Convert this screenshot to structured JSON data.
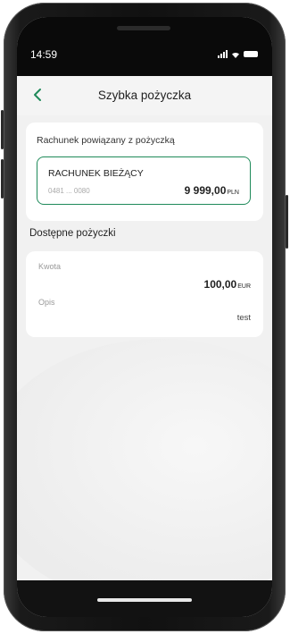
{
  "status_bar": {
    "time": "14:59"
  },
  "header": {
    "title": "Szybka pożyczka",
    "back_icon": "chevron-left-icon"
  },
  "linked_account": {
    "label": "Rachunek powiązany z pożyczką",
    "account_name": "RACHUNEK BIEŻĄCY",
    "account_number": "0481 ... 0080",
    "balance": "9 999,00",
    "currency": "PLN"
  },
  "available_loans": {
    "title": "Dostępne pożyczki",
    "amount_label": "Kwota",
    "amount_value": "100,00",
    "amount_currency": "EUR",
    "description_label": "Opis",
    "description_value": "test"
  },
  "colors": {
    "accent": "#1f8a5a",
    "background": "#f1f1f1",
    "card": "#ffffff"
  }
}
